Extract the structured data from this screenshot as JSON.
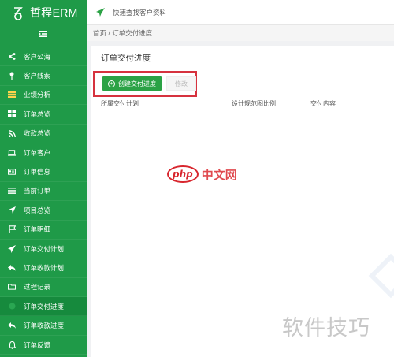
{
  "brand": {
    "name": "哲程ERM"
  },
  "topbar": {
    "text": "快速查找客户资料"
  },
  "breadcrumb": {
    "text": "首页 / 订单交付进度"
  },
  "panel": {
    "title": "订单交付进度",
    "create_button": "创建交付进度",
    "edit_button": "修改"
  },
  "table": {
    "columns": [
      "所属交付计划",
      "设计规范图比例",
      "交付内容"
    ]
  },
  "sidebar": {
    "items": [
      {
        "label": "客户公海",
        "icon": "share-icon"
      },
      {
        "label": "客户线索",
        "icon": "pin-icon"
      },
      {
        "label": "业绩分析",
        "icon": "bars-icon"
      },
      {
        "label": "订单总览",
        "icon": "grid-icon"
      },
      {
        "label": "收款总览",
        "icon": "rss-icon"
      },
      {
        "label": "订单客户",
        "icon": "laptop-icon"
      },
      {
        "label": "订单信息",
        "icon": "id-card-icon"
      },
      {
        "label": "当前订单",
        "icon": "list-icon"
      },
      {
        "label": "项目总览",
        "icon": "navigation-icon"
      },
      {
        "label": "订单明细",
        "icon": "flag-icon"
      },
      {
        "label": "订单交付计划",
        "icon": "paper-plane-icon"
      },
      {
        "label": "订单收款计划",
        "icon": "reply-icon"
      },
      {
        "label": "过程记录",
        "icon": "folder-icon"
      },
      {
        "label": "订单交付进度",
        "icon": "circle-icon"
      },
      {
        "label": "订单收款进度",
        "icon": "reply-icon"
      },
      {
        "label": "订单反馈",
        "icon": "bell-icon"
      }
    ]
  },
  "watermarks": {
    "php_badge": "php",
    "php_text": "中文网",
    "tips": "软件技巧"
  },
  "colors": {
    "sidebar": "#1f9a48",
    "primary_button": "#2ba245",
    "highlight_frame": "#d6323e",
    "watermark_red": "#d8262e"
  }
}
